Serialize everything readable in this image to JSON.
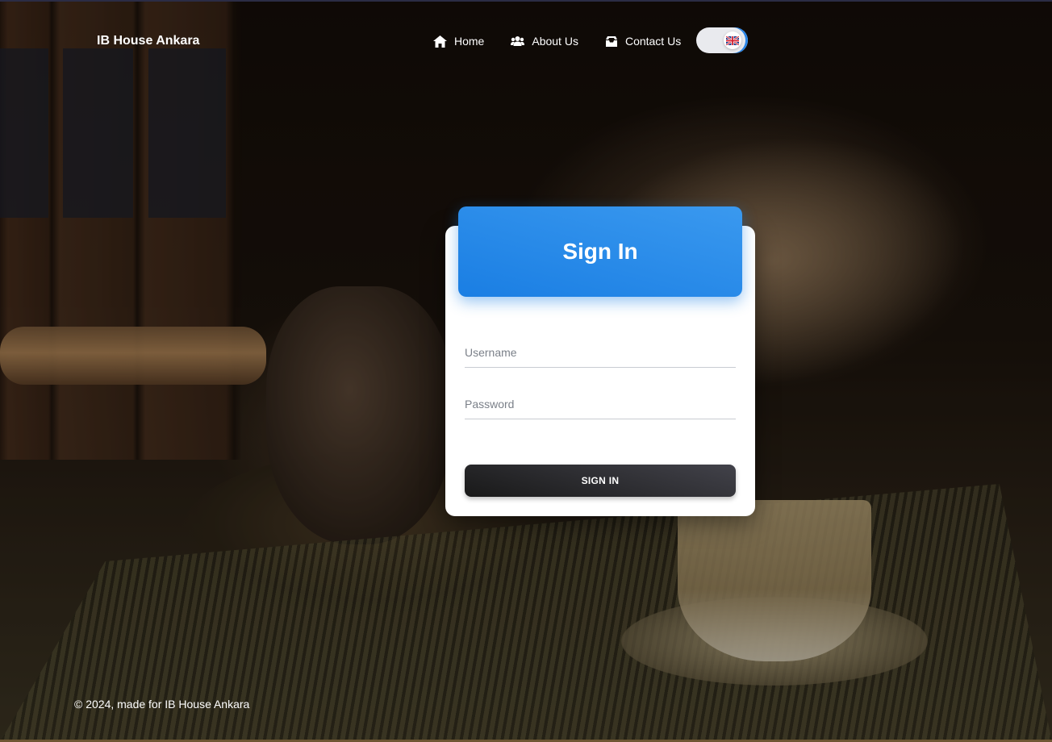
{
  "nav": {
    "brand": "IB House Ankara",
    "links": [
      {
        "label": "Home",
        "icon": "home-icon"
      },
      {
        "label": "About Us",
        "icon": "people-icon"
      },
      {
        "label": "Contact Us",
        "icon": "inbox-icon"
      }
    ],
    "language_flag": "uk-flag-icon"
  },
  "card": {
    "title": "Sign In",
    "username_placeholder": "Username",
    "password_placeholder": "Password",
    "button_label": "SIGN IN"
  },
  "footer": {
    "text": "© 2024, made for IB House Ankara"
  },
  "colors": {
    "accent": "#1a7ee3",
    "button": "#191919"
  }
}
